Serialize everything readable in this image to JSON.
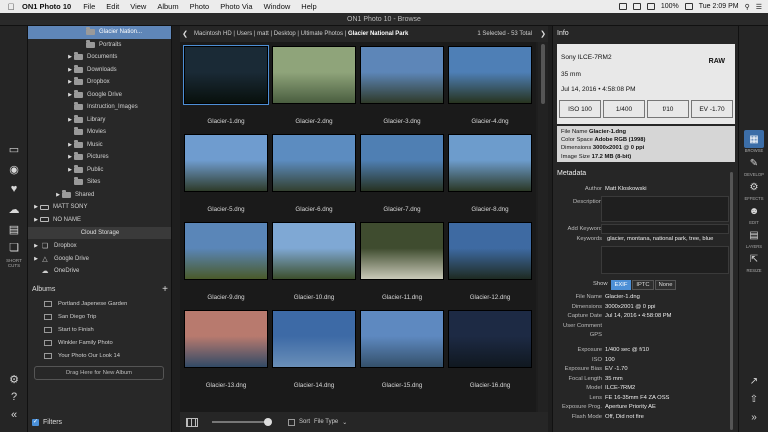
{
  "menubar": {
    "apple": "",
    "app_name": "ON1 Photo 10",
    "items": [
      "File",
      "Edit",
      "View",
      "Album",
      "Photo",
      "Photo Via",
      "Window",
      "Help"
    ],
    "battery": "100%",
    "time": "Tue 2:09 PM"
  },
  "window": {
    "title": "ON1 Photo 10 - Browse"
  },
  "left_strip": {
    "shortcuts_label": "SHORT CUTS"
  },
  "folders": {
    "items": [
      {
        "label": "Glacier Nation...",
        "selected": true
      },
      {
        "label": "Portraits"
      },
      {
        "label": "Documents"
      },
      {
        "label": "Downloads"
      },
      {
        "label": "Dropbox"
      },
      {
        "label": "Google Drive"
      },
      {
        "label": "Instruction_Images"
      },
      {
        "label": "Library"
      },
      {
        "label": "Movies"
      },
      {
        "label": "Music"
      },
      {
        "label": "Pictures"
      },
      {
        "label": "Public"
      },
      {
        "label": "Sites"
      },
      {
        "label": "Shared"
      },
      {
        "label": "MATT SONY"
      },
      {
        "label": "NO NAME"
      }
    ],
    "cloud_header": "Cloud Storage",
    "cloud_items": [
      "Dropbox",
      "Google Drive",
      "OneDrive"
    ]
  },
  "albums": {
    "title": "Albums",
    "items": [
      "Portland Japenese Garden",
      "San Diego Trip",
      "Start to Finish",
      "Winkler Family Photo",
      "Your Photo Our Look 14"
    ],
    "drop_label": "Drag Here for New Album"
  },
  "filters": {
    "label": "Filters",
    "rating": "≥☆☆☆☆☆"
  },
  "path": {
    "crumbs": [
      "Macintosh HD",
      "Users",
      "matt",
      "Desktop",
      "Ultimate Photos"
    ],
    "current": "Glacier National Park",
    "count": "1 Selected - 53 Total"
  },
  "photos": [
    {
      "name": "Glacier-1.dng",
      "top": "#1a2a36",
      "bottom": "#08100c",
      "selected": true
    },
    {
      "name": "Glacier-2.dng",
      "top": "#8fa47a",
      "bottom": "#4a5e40"
    },
    {
      "name": "Glacier-3.dng",
      "top": "#5d86b8",
      "bottom": "#2f3a2a"
    },
    {
      "name": "Glacier-4.dng",
      "top": "#4e7fb6",
      "bottom": "#27331f"
    },
    {
      "name": "Glacier-5.dng",
      "top": "#6f9ccf",
      "bottom": "#2e3b2a"
    },
    {
      "name": "Glacier-6.dng",
      "top": "#5c8cc0",
      "bottom": "#334030"
    },
    {
      "name": "Glacier-7.dng",
      "top": "#4f7fb3",
      "bottom": "#273222"
    },
    {
      "name": "Glacier-8.dng",
      "top": "#6d9ccc",
      "bottom": "#2b3826"
    },
    {
      "name": "Glacier-9.dng",
      "top": "#5a86b8",
      "bottom": "#4a5a2a"
    },
    {
      "name": "Glacier-10.dng",
      "top": "#7fa8d4",
      "bottom": "#3c4f2c"
    },
    {
      "name": "Glacier-11.dng",
      "top": "#3f4c2f",
      "bottom": "#c9c9b8"
    },
    {
      "name": "Glacier-12.dng",
      "top": "#3e6aa2",
      "bottom": "#1e2a22"
    },
    {
      "name": "Glacier-13.dng",
      "top": "#b87a6e",
      "bottom": "#324a66"
    },
    {
      "name": "Glacier-14.dng",
      "top": "#3d6aa6",
      "bottom": "#6a8fb8"
    },
    {
      "name": "Glacier-15.dng",
      "top": "#5e89c0",
      "bottom": "#34506a"
    },
    {
      "name": "Glacier-16.dng",
      "top": "#1d2a44",
      "bottom": "#101820"
    }
  ],
  "bottombar": {
    "sort_label": "Sort",
    "sort_value": "File Type"
  },
  "info": {
    "header": "Info",
    "camera": "Sony ILCE-7RM2",
    "format": "RAW",
    "focal": "35 mm",
    "datetime": "Jul 14, 2016 • 4:58:08 PM",
    "exposure": [
      "ISO 100",
      "1/400",
      "f/10",
      "EV -1.70"
    ],
    "file": [
      {
        "k": "File Name",
        "v": "Glacier-1.dng"
      },
      {
        "k": "Color Space",
        "v": "Adobe RGB (1998)"
      },
      {
        "k": "Dimensions",
        "v": "3000x2001 @ 0 ppi"
      },
      {
        "k": "Image Size",
        "v": "17.2 MB (8-bit)"
      }
    ]
  },
  "metadata": {
    "header": "Metadata",
    "author_label": "Author",
    "author": "Matt Kloskowski",
    "description_label": "Description",
    "add_keyword_label": "Add Keyword",
    "keywords_label": "Keywords",
    "keywords": "glacier, montana, national park, tree, blue",
    "show_label": "Show",
    "tabs": [
      "EXIF",
      "IPTC",
      "None"
    ],
    "exif": [
      {
        "k": "File Name",
        "v": "Glacier-1.dng"
      },
      {
        "k": "Dimensions",
        "v": "3000x2001 @ 0 ppi"
      },
      {
        "k": "Capture Date",
        "v": "Jul 14, 2016 • 4:58:08 PM"
      },
      {
        "k": "User Comment",
        "v": ""
      },
      {
        "k": "GPS",
        "v": ""
      },
      {
        "k": "Exposure",
        "v": "1/400 sec @ f/10"
      },
      {
        "k": "ISO",
        "v": "100"
      },
      {
        "k": "Exposure Bias",
        "v": "EV -1.70"
      },
      {
        "k": "Focal Length",
        "v": "35 mm"
      },
      {
        "k": "Model",
        "v": "ILCE-7RM2"
      },
      {
        "k": "Lens",
        "v": "FE 16-35mm F4 ZA OSS"
      },
      {
        "k": "Exposure Prog.",
        "v": "Aperture Priority AE"
      },
      {
        "k": "Flash Mode",
        "v": "Off, Did not fire"
      }
    ]
  },
  "right_strip": {
    "labels": [
      "BROWSE",
      "DEVELOP",
      "EFFECTS",
      "EDIT",
      "LAYERS",
      "RESIZE"
    ]
  }
}
